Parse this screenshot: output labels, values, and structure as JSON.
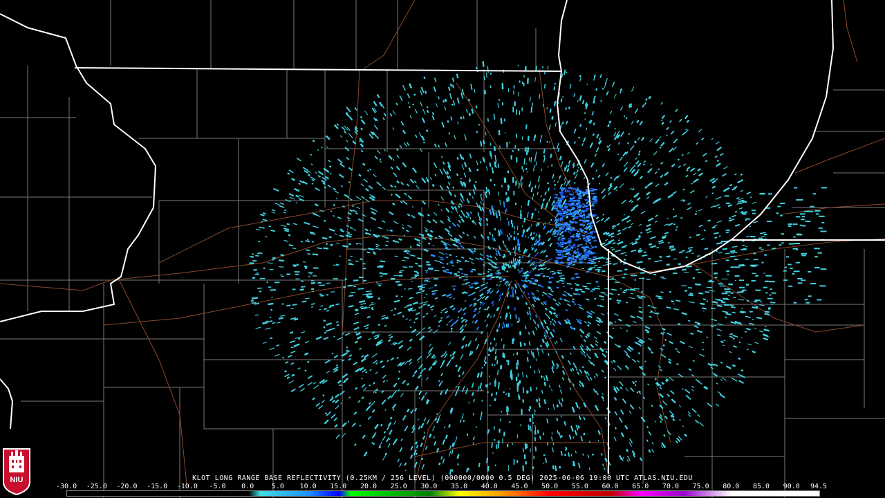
{
  "product": {
    "caption": "KLOT LONG RANGE BASE REFLECTIVITY (0.25KM / 256 LEVEL) (000000/0000 0.5 DEG) 2025-06-06 19:00 UTC  ATLAS.NIU.EDU"
  },
  "color_scale": {
    "labels": [
      "-30.0",
      "-25.0",
      "-20.0",
      "-15.0",
      "-10.0",
      "-5.0",
      "0.0",
      "5.0",
      "10.0",
      "15.0",
      "20.0",
      "25.0",
      "30.0",
      "35.0",
      "40.0",
      "45.0",
      "50.0",
      "55.0",
      "60.0",
      "65.0",
      "70.0",
      "75.0",
      "80.0",
      "85.0",
      "90.0",
      "94.5"
    ],
    "min": -30.0,
    "max": 94.5,
    "stops": [
      {
        "value": -30.0,
        "color": "#000000"
      },
      {
        "value": 0.0,
        "color": "#000000"
      },
      {
        "value": 2.0,
        "color": "#40e0e0"
      },
      {
        "value": 10.0,
        "color": "#1e90ff"
      },
      {
        "value": 15.0,
        "color": "#0000ff"
      },
      {
        "value": 17.0,
        "color": "#00ff00"
      },
      {
        "value": 30.0,
        "color": "#008000"
      },
      {
        "value": 35.0,
        "color": "#ffff00"
      },
      {
        "value": 42.0,
        "color": "#ff9900"
      },
      {
        "value": 50.0,
        "color": "#ff0000"
      },
      {
        "value": 60.0,
        "color": "#c00000"
      },
      {
        "value": 65.0,
        "color": "#ff00ff"
      },
      {
        "value": 72.0,
        "color": "#9900cc"
      },
      {
        "value": 80.0,
        "color": "#ffffff"
      },
      {
        "value": 94.5,
        "color": "#ffffff"
      }
    ]
  },
  "logo": {
    "text": "NIU",
    "color": "#c8102e"
  },
  "map_colors": {
    "state_borders": "#ffffff",
    "county_borders": "#7a7a7a",
    "highways": "#8b4a2a",
    "echo_light": "#40d0e0",
    "echo_mid": "#2a8cff",
    "echo_strong": "#1f4fe0"
  }
}
